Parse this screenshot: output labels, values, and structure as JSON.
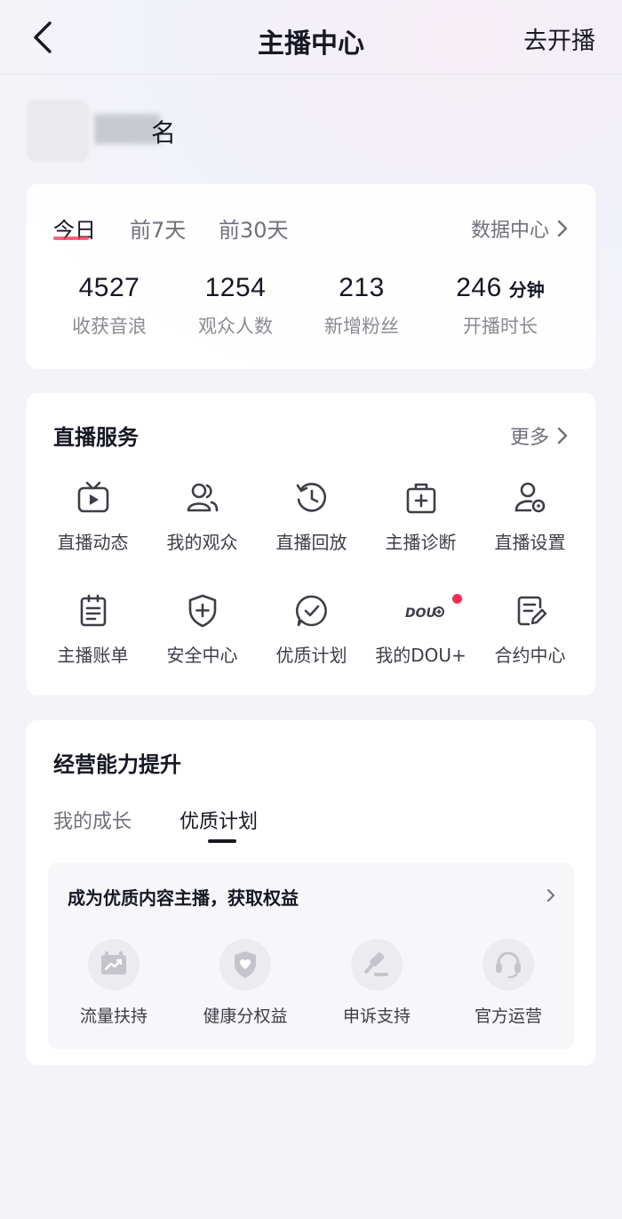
{
  "nav": {
    "title": "主播中心",
    "action": "去开播"
  },
  "profile": {
    "name_suffix": "名"
  },
  "overview": {
    "tabs": [
      "今日",
      "前7天",
      "前30天"
    ],
    "active_tab": "今日",
    "data_center": "数据中心",
    "stats": [
      {
        "value": "4527",
        "unit": "",
        "label": "收获音浪"
      },
      {
        "value": "1254",
        "unit": "",
        "label": "观众人数"
      },
      {
        "value": "213",
        "unit": "",
        "label": "新增粉丝"
      },
      {
        "value": "246",
        "unit": "分钟",
        "label": "开播时长"
      }
    ]
  },
  "services": {
    "title": "直播服务",
    "more": "更多",
    "items": [
      {
        "label": "直播动态",
        "icon": "tv-icon"
      },
      {
        "label": "我的观众",
        "icon": "users-icon"
      },
      {
        "label": "直播回放",
        "icon": "history-icon"
      },
      {
        "label": "主播诊断",
        "icon": "medkit-icon"
      },
      {
        "label": "直播设置",
        "icon": "user-settings-icon"
      },
      {
        "label": "主播账单",
        "icon": "clipboard-icon"
      },
      {
        "label": "安全中心",
        "icon": "shield-plus-icon"
      },
      {
        "label": "优质计划",
        "icon": "check-chat-icon"
      },
      {
        "label": "我的DOU+",
        "icon": "dou-logo-icon",
        "badge_logo": "DOU",
        "has_dot": true
      },
      {
        "label": "合约中心",
        "icon": "contract-edit-icon"
      }
    ]
  },
  "growth": {
    "title": "经营能力提升",
    "tabs": [
      "我的成长",
      "优质计划"
    ],
    "active_tab": "优质计划",
    "banner": "成为优质内容主播，获取权益",
    "benefits": [
      {
        "label": "流量扶持",
        "icon": "traffic-chart-icon"
      },
      {
        "label": "健康分权益",
        "icon": "heart-shield-icon"
      },
      {
        "label": "申诉支持",
        "icon": "gavel-icon"
      },
      {
        "label": "官方运营",
        "icon": "headset-icon"
      }
    ]
  },
  "colors": {
    "accent": "#fe2c55",
    "text": "#161823",
    "muted": "#6f7079",
    "background": "#f4f4f8"
  }
}
